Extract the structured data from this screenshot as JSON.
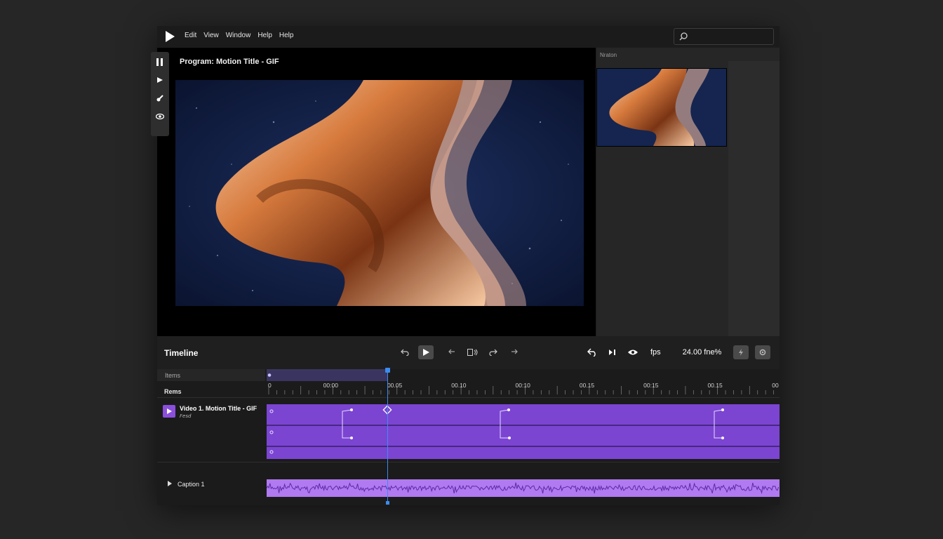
{
  "menu": [
    "Edit",
    "View",
    "Window",
    "Help",
    "Help"
  ],
  "program": {
    "title": "Program: Motion Title - GIF"
  },
  "right_panel": {
    "label": "Nraton"
  },
  "timeline": {
    "title": "Timeline",
    "fps_label": "fps",
    "fps_value": "24.00 fne%",
    "items_label": "Items",
    "rems_label": "Rems",
    "ticks": [
      "0",
      "00:00",
      "00.05",
      "00.10",
      "00:10",
      "00.15",
      "00:15",
      "00.15",
      "00"
    ],
    "video_track": {
      "name": "Video 1. Motion Title - GIF",
      "sub": "𝘍𝘦𝘴𝘥"
    },
    "caption_track": {
      "name": "Caption 1"
    },
    "playhead_time_fraction": 0.237
  },
  "colors": {
    "accent": "#8b4fdc",
    "clip": "#7b45d2",
    "playhead": "#3b8cf0",
    "wave": "#b17af0"
  },
  "icons": [
    "play-logo-icon",
    "search-icon",
    "pause-icon",
    "select-icon",
    "brush-icon",
    "eye-icon",
    "undo-icon",
    "play-icon",
    "redo-icon",
    "trim-icon",
    "settings-icon"
  ]
}
